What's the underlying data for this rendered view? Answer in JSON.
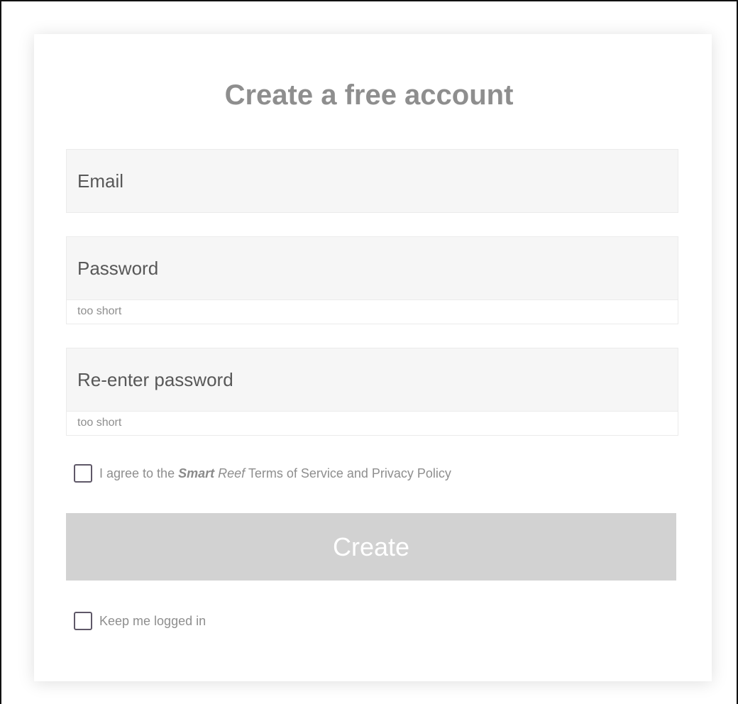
{
  "form": {
    "title": "Create a free account",
    "email": {
      "placeholder": "Email",
      "value": ""
    },
    "password": {
      "placeholder": "Password",
      "value": "",
      "hint": "too short"
    },
    "confirm_password": {
      "placeholder": "Re-enter password",
      "value": "",
      "hint": "too short"
    },
    "terms": {
      "checked": false,
      "text_before": "I agree to the ",
      "brand_bold": "Smart",
      "brand_light": " Reef",
      "text_after": " Terms of Service and Privacy Policy"
    },
    "create_label": "Create",
    "keep_logged_in": {
      "checked": false,
      "label": "Keep me logged in"
    }
  },
  "colors": {
    "title": "#8e8e8e",
    "field_bg": "#f6f6f6",
    "button_disabled_bg": "#d2d2d2",
    "checkbox_border": "#5f5868"
  }
}
